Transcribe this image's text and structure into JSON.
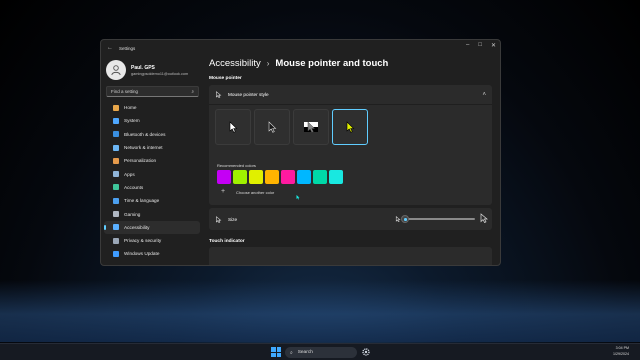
{
  "window": {
    "title": "Settings"
  },
  "profile": {
    "name": "Paul. GPS",
    "email": "gamingpsoldemo11@outlook.com"
  },
  "search": {
    "placeholder": "Find a setting"
  },
  "sidebar": {
    "items": [
      {
        "label": "Home",
        "icon": "home-icon",
        "color": "#e8a64a"
      },
      {
        "label": "System",
        "icon": "system-icon",
        "color": "#4ea7ff"
      },
      {
        "label": "Bluetooth & devices",
        "icon": "bluetooth-icon",
        "color": "#3a8fe0"
      },
      {
        "label": "Network & internet",
        "icon": "network-icon",
        "color": "#6cb6f5"
      },
      {
        "label": "Personalization",
        "icon": "personalization-icon",
        "color": "#e59a4b"
      },
      {
        "label": "Apps",
        "icon": "apps-icon",
        "color": "#8fb4d8"
      },
      {
        "label": "Accounts",
        "icon": "accounts-icon",
        "color": "#3fc69a"
      },
      {
        "label": "Time & language",
        "icon": "time-language-icon",
        "color": "#4ca0f0"
      },
      {
        "label": "Gaming",
        "icon": "gaming-icon",
        "color": "#b0b7c2"
      },
      {
        "label": "Accessibility",
        "icon": "accessibility-icon",
        "color": "#5ab0ff"
      },
      {
        "label": "Privacy & security",
        "icon": "shield-icon",
        "color": "#9aa6b6"
      },
      {
        "label": "Windows Update",
        "icon": "windows-update-icon",
        "color": "#3f9cff"
      }
    ]
  },
  "breadcrumb": {
    "parent": "Accessibility",
    "separator": "›",
    "current": "Mouse pointer and touch"
  },
  "sections": {
    "mouse_pointer": "Mouse pointer",
    "touch_indicator": "Touch indicator"
  },
  "pointer_style": {
    "label": "Mouse pointer style",
    "options": [
      "white",
      "black",
      "inverted",
      "custom"
    ],
    "selected": "custom"
  },
  "colors": {
    "label": "Recommended colors",
    "swatches": [
      "#c400f5",
      "#a0f000",
      "#e0f000",
      "#ffb300",
      "#ff1aa0",
      "#00b7ff",
      "#00d8a8",
      "#19e8e0"
    ],
    "choose_label": "Choose another color",
    "accent": "#60cdff"
  },
  "size": {
    "label": "Size",
    "value": 1,
    "min": 1,
    "max": 15
  },
  "taskbar": {
    "search_label": "Search",
    "time": "3:04 PM",
    "date": "1/29/2024"
  }
}
